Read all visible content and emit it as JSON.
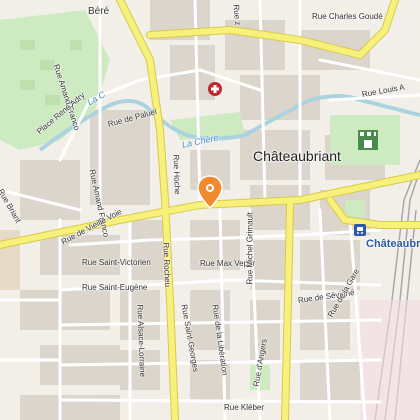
{
  "map": {
    "places": {
      "town": "Châteaubriant",
      "station": "Châteaubriant",
      "bere": "Béré"
    },
    "water": {
      "la_chere": "La Chère",
      "la_c": "La C"
    },
    "streets": {
      "charles_goude": "Rue Charles Goudé",
      "amand_franco_north": "Rue Amand Franco",
      "amand_franco_south": "Rue Amand Franco",
      "rene_adry": "Place René Adry",
      "paluel": "Rue de Paluel",
      "hoche": "Rue Hoche",
      "briant": "Rue Briant",
      "vieille_voie": "Rue de Vieille Voie",
      "saint_victorien": "Rue Saint-Victorien",
      "saint_eugene": "Rue Saint-Eugène",
      "alsace_lorraine": "Rue Alsace-Lorraine",
      "rocheu": "Rue Rocheu",
      "saint_georges": "Rue Saint-Georges",
      "max_veper": "Rue Max Veper",
      "liberation": "Rue de la Libération",
      "michel_grimault": "Rue Michel Grimault",
      "sevigne": "Rue de Sévigné",
      "la_gare": "Rue de la Gare",
      "angers": "Rue d'Angers",
      "kleber": "Rue Kléber",
      "louis": "Rue Louis A",
      "ruez": "Rue z"
    },
    "colors": {
      "background": "#f2efe9",
      "road_major": "#f7f07a",
      "road_major_casing": "#d9c94a",
      "road_minor": "#ffffff",
      "building": "#dcd5cc",
      "park": "#cdeac0",
      "water": "#aad3df",
      "marker": "#f08a2c",
      "hospital": "#c0272d"
    },
    "icons": [
      "location-marker-icon",
      "hospital-icon",
      "castle-icon",
      "train-station-icon"
    ]
  }
}
